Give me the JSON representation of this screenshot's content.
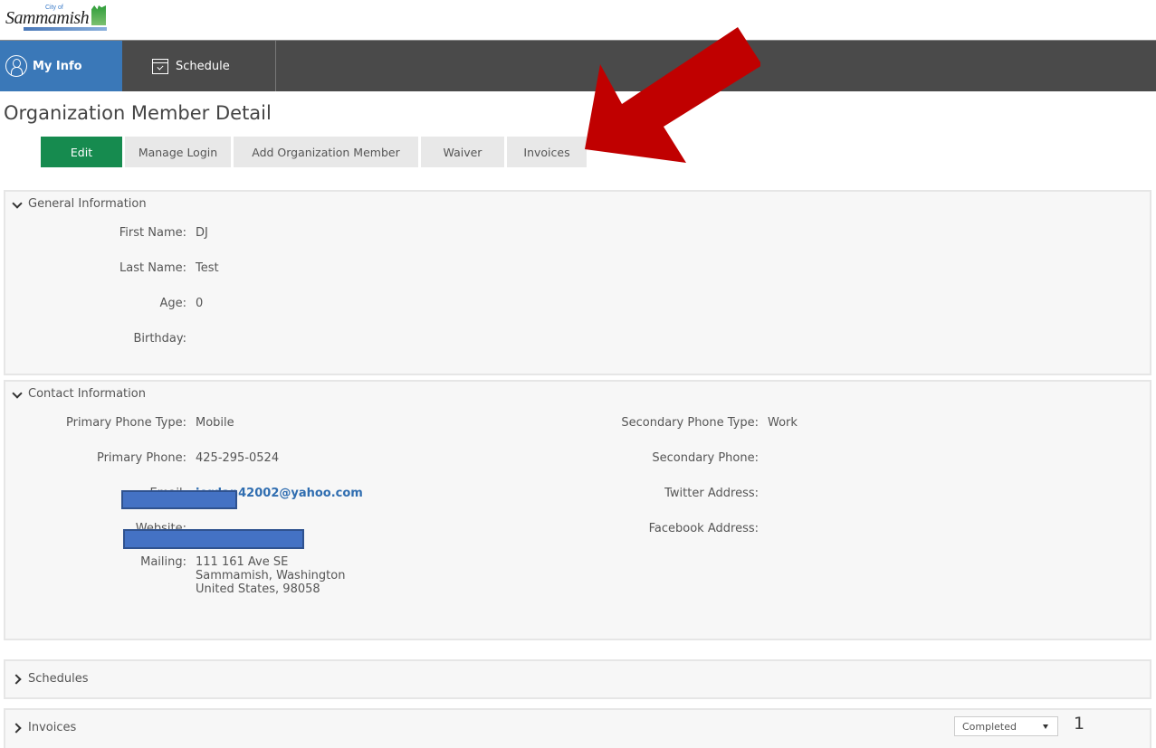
{
  "logo": {
    "city_label": "City of",
    "name": "Sammamish"
  },
  "nav": {
    "items": [
      {
        "label": "My Info",
        "icon": "person-circle-icon",
        "active": true
      },
      {
        "label": "Schedule",
        "icon": "calendar-check-icon",
        "active": false
      }
    ]
  },
  "page": {
    "title": "Organization Member Detail"
  },
  "actions": {
    "edit": "Edit",
    "manage_login": "Manage Login",
    "add_member": "Add Organization Member",
    "waiver": "Waiver",
    "invoices": "Invoices"
  },
  "general": {
    "title": "General Information",
    "fields": [
      {
        "label": "First Name:",
        "value": "DJ"
      },
      {
        "label": "Last Name:",
        "value": "Test"
      },
      {
        "label": "Age:",
        "value": "0"
      },
      {
        "label": "Birthday:",
        "value": ""
      }
    ]
  },
  "contact": {
    "title": "Contact Information",
    "left": [
      {
        "label": "Primary Phone Type:",
        "value": "Mobile"
      },
      {
        "label": "Primary Phone:",
        "value": "425-295-0524"
      },
      {
        "label": "Email:",
        "value": "jordan42002@yahoo.com"
      },
      {
        "label": "Website:",
        "value": ""
      },
      {
        "label": "Mailing:",
        "value": "111 161 Ave SE",
        "value2": "Sammamish, Washington",
        "value3": "United States, 98058"
      }
    ],
    "right": [
      {
        "label": "Secondary Phone Type:",
        "value": "Work"
      },
      {
        "label": "Secondary Phone:",
        "value": ""
      },
      {
        "label": "Twitter Address:",
        "value": ""
      },
      {
        "label": "Facebook Address:",
        "value": ""
      }
    ]
  },
  "schedules": {
    "title": "Schedules"
  },
  "invoices": {
    "title": "Invoices",
    "status_selected": "Completed",
    "count": "1"
  },
  "annotation": {
    "arrow_color": "#c00000",
    "redaction_color": "#4472c4"
  }
}
